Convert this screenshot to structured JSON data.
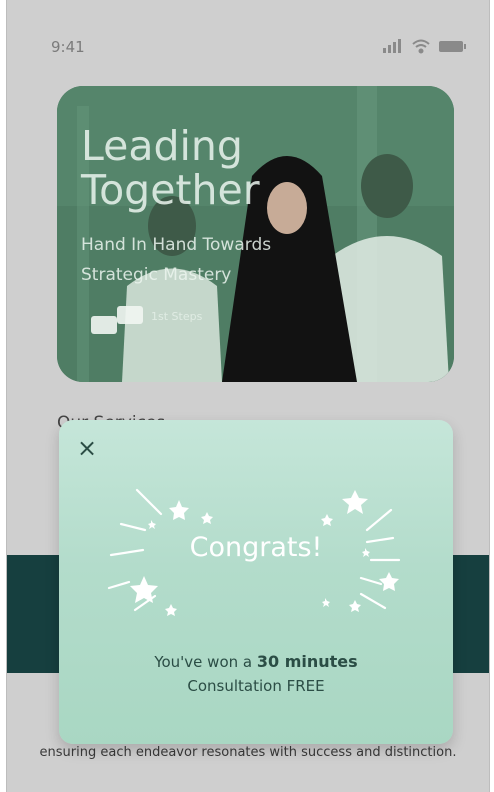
{
  "status_bar": {
    "time": "9:41"
  },
  "hero": {
    "title_line1": "Leading",
    "title_line2": "Together",
    "subtitle": "Hand In Hand Towards Strategic Mastery",
    "steps_label": "1st Steps"
  },
  "services": {
    "title": "Our Services"
  },
  "footer_text": "ensuring each endeavor resonates with success and distinction.",
  "modal": {
    "close_symbol": "×",
    "title": "Congrats!",
    "message_prefix": "You've won a",
    "message_highlight": "30 minutes",
    "message_suffix": "Consultation FREE"
  },
  "colors": {
    "dark_band": "#163f3f",
    "modal_bg": "#b8dfcf",
    "hero_tint": "#4f7d64"
  }
}
